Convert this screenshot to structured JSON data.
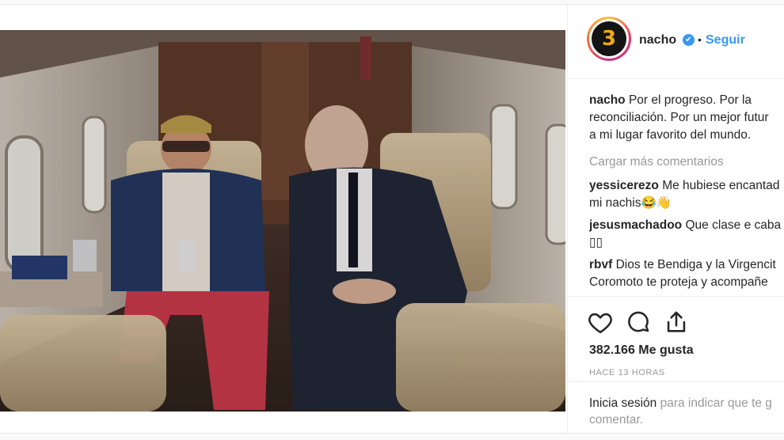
{
  "post": {
    "username": "nacho",
    "follow_label": "Seguir",
    "separator": "•",
    "verified_glyph": "✔",
    "avatar_glyph": "3",
    "caption_user": "nacho",
    "caption_lines": [
      "Por el progreso. Por la",
      "reconciliación. Por un mejor futur",
      "a mi lugar favorito del mundo."
    ],
    "load_more": "Cargar más comentarios",
    "comments": [
      {
        "user": "yessicerezo",
        "line1": "Me hubiese encantad",
        "line2": "mi nachis😂👋"
      },
      {
        "user": "jesusmachadoo",
        "line1": "Que clase e caba",
        "line2": "▯▯"
      },
      {
        "user": "rbvf",
        "line1": "Dios te Bendiga y la Virgencit",
        "line2": "Coromoto te proteja y acompañe"
      }
    ],
    "likes": "382.166 Me gusta",
    "time": "HACE 13 HORAS",
    "login_link": "Inicia sesión",
    "login_rest": " para indicar que te g",
    "login_line2": "comentar."
  },
  "icons": {
    "like": "heart-icon",
    "comment": "speech-bubble-icon",
    "share": "share-icon",
    "verified": "verified-badge-icon"
  },
  "colors": {
    "accent": "#3897f0",
    "muted": "#999999",
    "text": "#262626"
  }
}
